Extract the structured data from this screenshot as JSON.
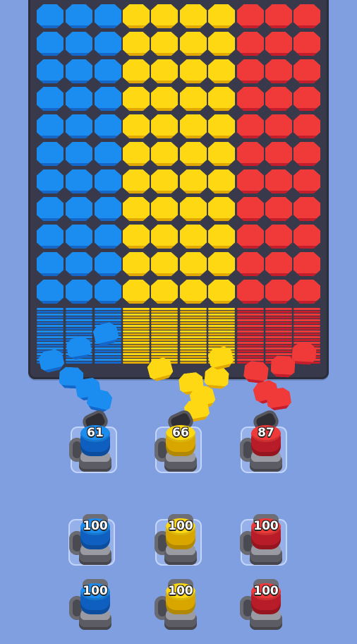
{
  "board": {
    "columns": [
      {
        "color": "#1b8cf0",
        "shade": "#1466c8",
        "name": "blue"
      },
      {
        "color": "#ffd814",
        "shade": "#e0a800",
        "name": "yellow"
      },
      {
        "color": "#f03a3a",
        "shade": "#c41e2c",
        "name": "red"
      }
    ]
  },
  "launchers": {
    "active": [
      {
        "color_name": "blue",
        "count": "61",
        "color": "#1b8cf0",
        "dark": "#0f5fc0"
      },
      {
        "color_name": "yellow",
        "count": "66",
        "color": "#ffd814",
        "dark": "#d9a600"
      },
      {
        "color_name": "red",
        "count": "87",
        "color": "#f03a3a",
        "dark": "#b81c28"
      }
    ],
    "queue_row1": [
      {
        "color_name": "blue",
        "count": "100",
        "color": "#1b8cf0",
        "dark": "#0f5fc0"
      },
      {
        "color_name": "yellow",
        "count": "100",
        "color": "#ffd814",
        "dark": "#d9a600"
      },
      {
        "color_name": "red",
        "count": "100",
        "color": "#f03a3a",
        "dark": "#b81c28"
      }
    ],
    "queue_row2": [
      {
        "color_name": "blue",
        "count": "100",
        "color": "#1b8cf0",
        "dark": "#0f5fc0"
      },
      {
        "color_name": "yellow",
        "count": "100",
        "color": "#ffd814",
        "dark": "#d9a600"
      },
      {
        "color_name": "red",
        "count": "100",
        "color": "#f03a3a",
        "dark": "#b81c28"
      }
    ]
  }
}
